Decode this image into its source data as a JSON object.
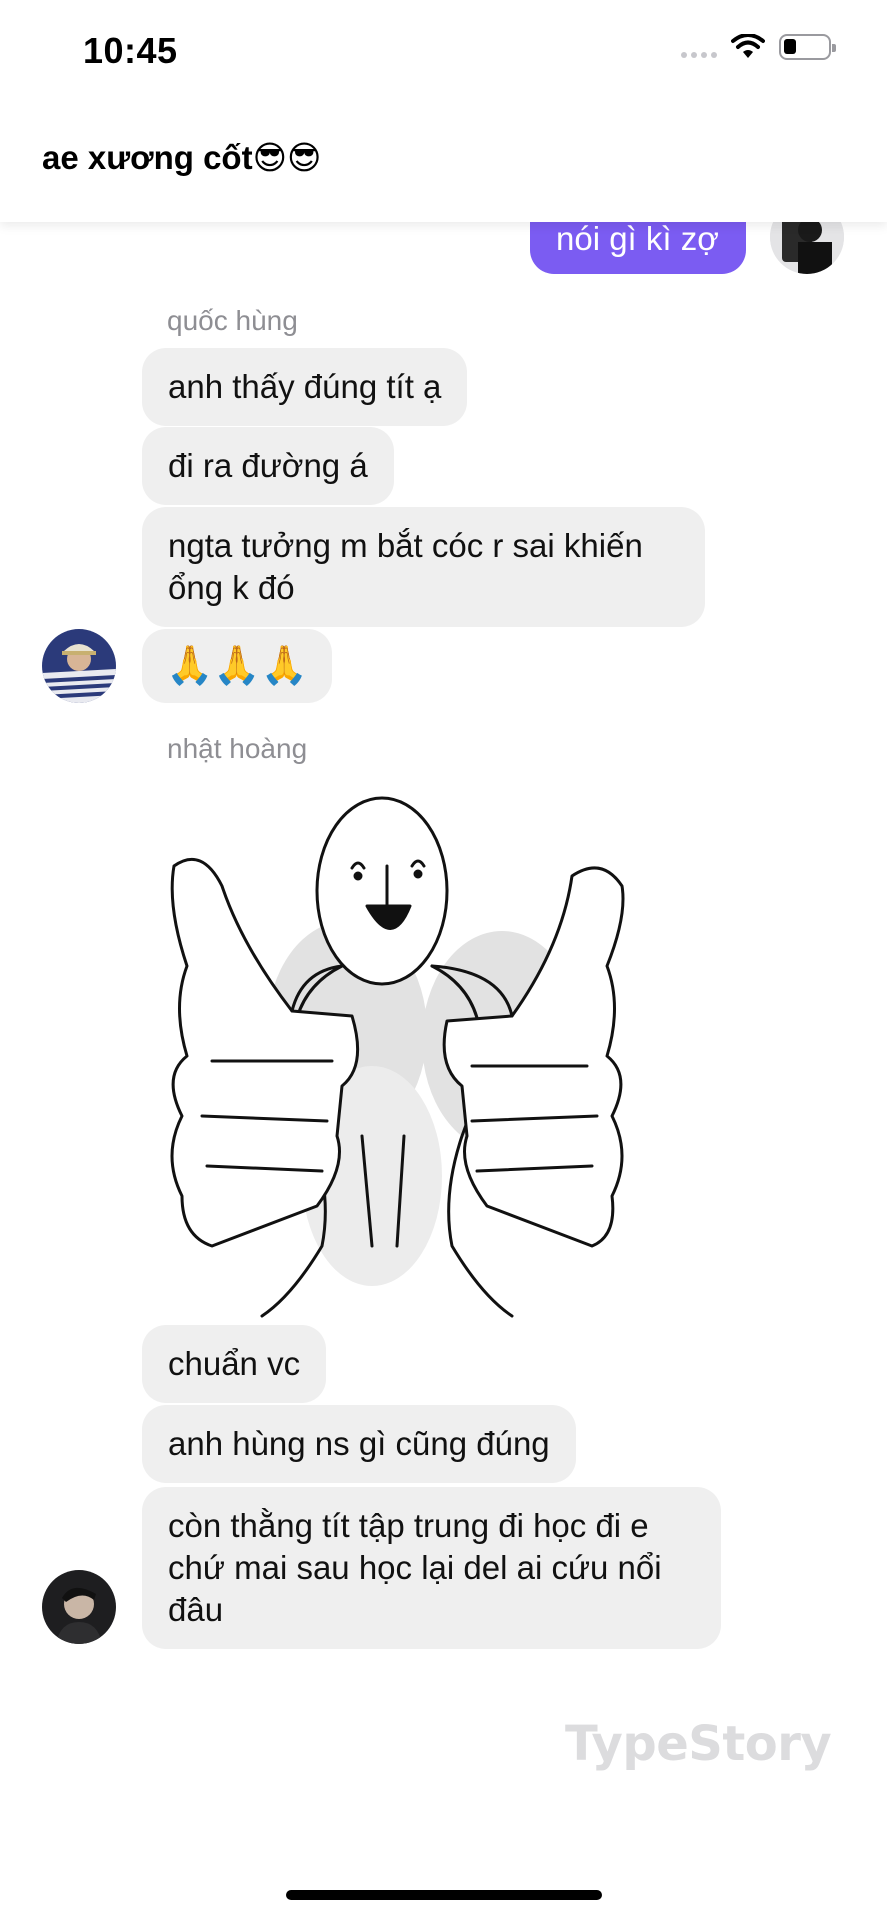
{
  "status_bar": {
    "time": "10:45"
  },
  "header": {
    "title": "ae xương cốt😎😎"
  },
  "messages": {
    "outgoing": {
      "text": "nói gì kì zợ"
    },
    "group1": {
      "sender": "quốc hùng",
      "m1": "anh thấy đúng tít ạ",
      "m2": "đi ra đường á",
      "m3": "ngta tưởng m bắt cóc r sai khiến ổng k đó",
      "m4": "🙏🙏🙏"
    },
    "group2": {
      "sender": "nhật hoàng",
      "m1": "chuẩn vc",
      "m2": "anh hùng ns gì cũng đúng",
      "m3": "còn thằng tít tập trung đi học đi e chứ mai sau học lại del ai cứu nổi đâu"
    }
  },
  "watermark": "TypeStory",
  "colors": {
    "accent": "#7b5cf2",
    "bubble": "#efefef",
    "sender": "#8e8e93"
  }
}
